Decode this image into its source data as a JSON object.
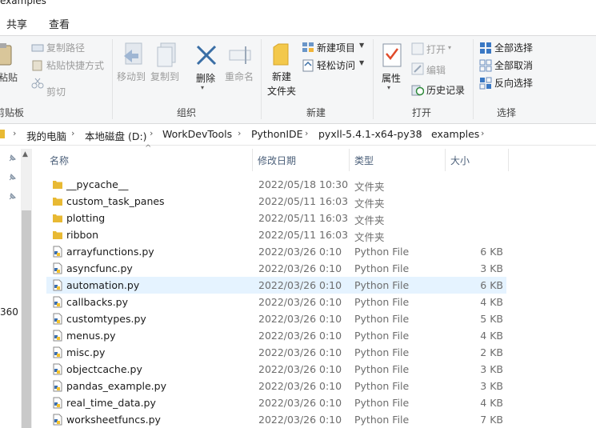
{
  "window": {
    "title": "examples"
  },
  "tabs": [
    "共享",
    "查看"
  ],
  "ribbon": {
    "clipboard": {
      "paste": "粘贴",
      "copy_path": "复制路径",
      "paste_shortcut": "粘贴快捷方式",
      "cut": "剪切",
      "group": "剪贴板"
    },
    "organize": {
      "move_to": "移动到",
      "copy_to": "复制到",
      "delete": "删除",
      "rename": "重命名",
      "group": "组织"
    },
    "new": {
      "new_folder_line1": "新建",
      "new_folder_line2": "文件夹",
      "new_item": "新建项目",
      "easy_access": "轻松访问",
      "group": "新建"
    },
    "open": {
      "properties": "属性",
      "open": "打开",
      "edit": "编辑",
      "history": "历史记录",
      "group": "打开"
    },
    "select": {
      "select_all": "全部选择",
      "select_none": "全部取消",
      "invert": "反向选择",
      "group": "选择"
    }
  },
  "address": {
    "crumbs": [
      "我的电脑",
      "本地磁盘 (D:)",
      "WorkDevTools",
      "PythonIDE",
      "pyxll-5.4.1-x64-py38",
      "examples"
    ]
  },
  "nav": {
    "partial_label": "360"
  },
  "columns": {
    "name": "名称",
    "date": "修改日期",
    "type": "类型",
    "size": "大小"
  },
  "files": [
    {
      "name": "__pycache__",
      "date": "2022/05/18 10:30",
      "type": "文件夹",
      "size": "",
      "kind": "folder"
    },
    {
      "name": "custom_task_panes",
      "date": "2022/05/11 16:03",
      "type": "文件夹",
      "size": "",
      "kind": "folder"
    },
    {
      "name": "plotting",
      "date": "2022/05/11 16:03",
      "type": "文件夹",
      "size": "",
      "kind": "folder"
    },
    {
      "name": "ribbon",
      "date": "2022/05/11 16:03",
      "type": "文件夹",
      "size": "",
      "kind": "folder"
    },
    {
      "name": "arrayfunctions.py",
      "date": "2022/03/26 0:10",
      "type": "Python File",
      "size": "6 KB",
      "kind": "py"
    },
    {
      "name": "asyncfunc.py",
      "date": "2022/03/26 0:10",
      "type": "Python File",
      "size": "3 KB",
      "kind": "py"
    },
    {
      "name": "automation.py",
      "date": "2022/03/26 0:10",
      "type": "Python File",
      "size": "6 KB",
      "kind": "py",
      "selected": true
    },
    {
      "name": "callbacks.py",
      "date": "2022/03/26 0:10",
      "type": "Python File",
      "size": "4 KB",
      "kind": "py"
    },
    {
      "name": "customtypes.py",
      "date": "2022/03/26 0:10",
      "type": "Python File",
      "size": "5 KB",
      "kind": "py"
    },
    {
      "name": "menus.py",
      "date": "2022/03/26 0:10",
      "type": "Python File",
      "size": "4 KB",
      "kind": "py"
    },
    {
      "name": "misc.py",
      "date": "2022/03/26 0:10",
      "type": "Python File",
      "size": "2 KB",
      "kind": "py"
    },
    {
      "name": "objectcache.py",
      "date": "2022/03/26 0:10",
      "type": "Python File",
      "size": "3 KB",
      "kind": "py"
    },
    {
      "name": "pandas_example.py",
      "date": "2022/03/26 0:10",
      "type": "Python File",
      "size": "3 KB",
      "kind": "py"
    },
    {
      "name": "real_time_data.py",
      "date": "2022/03/26 0:10",
      "type": "Python File",
      "size": "4 KB",
      "kind": "py"
    },
    {
      "name": "worksheetfuncs.py",
      "date": "2022/03/26 0:10",
      "type": "Python File",
      "size": "7 KB",
      "kind": "py"
    }
  ],
  "colors": {
    "folder": "#e8b933",
    "selection": "#e5f3ff",
    "accent": "#1e78d7",
    "delete_x": "#3a6ea5"
  },
  "icons": {
    "folder": "folder-icon",
    "py": "python-file-icon",
    "pin": "pin-icon",
    "select_all": "select-all-icon"
  }
}
